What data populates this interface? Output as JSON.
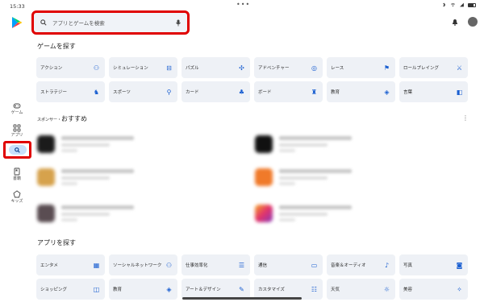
{
  "status_bar": {
    "time": "15:33",
    "dots": "•••"
  },
  "search": {
    "placeholder": "アプリとゲームを検索"
  },
  "left_nav": {
    "items": [
      {
        "label": "ゲーム",
        "icon": "gamepad-icon"
      },
      {
        "label": "アプリ",
        "icon": "apps-icon"
      },
      {
        "label": "",
        "icon": "search-icon",
        "active": true
      },
      {
        "label": "書籍",
        "icon": "book-icon"
      },
      {
        "label": "キッズ",
        "icon": "kids-icon"
      }
    ]
  },
  "games_section": {
    "title": "ゲームを探す",
    "chips": [
      {
        "label": "アクション",
        "icon": "action-icon"
      },
      {
        "label": "シミュレーション",
        "icon": "simulation-icon"
      },
      {
        "label": "パズル",
        "icon": "puzzle-icon"
      },
      {
        "label": "アドベンチャー",
        "icon": "compass-icon"
      },
      {
        "label": "レース",
        "icon": "flag-icon"
      },
      {
        "label": "ロールプレイング",
        "icon": "swords-icon"
      },
      {
        "label": "ストラテジー",
        "icon": "strategy-icon"
      },
      {
        "label": "スポーツ",
        "icon": "sports-icon"
      },
      {
        "label": "カード",
        "icon": "card-icon"
      },
      {
        "label": "ボード",
        "icon": "board-icon"
      },
      {
        "label": "教育",
        "icon": "school-icon"
      },
      {
        "label": "言葉",
        "icon": "word-icon"
      }
    ]
  },
  "sponsored": {
    "prefix": "スポンサー・",
    "title": "おすすめ"
  },
  "apps_section": {
    "title": "アプリを探す",
    "chips": [
      {
        "label": "エンタメ",
        "icon": "calendar-icon"
      },
      {
        "label": "ソーシャルネットワーク",
        "icon": "people-icon"
      },
      {
        "label": "仕事効率化",
        "icon": "list-icon"
      },
      {
        "label": "通信",
        "icon": "chat-icon"
      },
      {
        "label": "音楽＆オーディオ",
        "icon": "music-icon"
      },
      {
        "label": "写真",
        "icon": "camera-icon"
      },
      {
        "label": "ショッピング",
        "icon": "bag-icon"
      },
      {
        "label": "教育",
        "icon": "school-icon"
      },
      {
        "label": "アート＆デザイン",
        "icon": "brush-icon"
      },
      {
        "label": "カスタマイズ",
        "icon": "tune-icon"
      },
      {
        "label": "天気",
        "icon": "weather-icon"
      },
      {
        "label": "美容",
        "icon": "beauty-icon"
      }
    ]
  },
  "colors": {
    "accent": "#1a5fd1",
    "highlight": "#e00000",
    "chip_bg": "#eef1f6"
  }
}
